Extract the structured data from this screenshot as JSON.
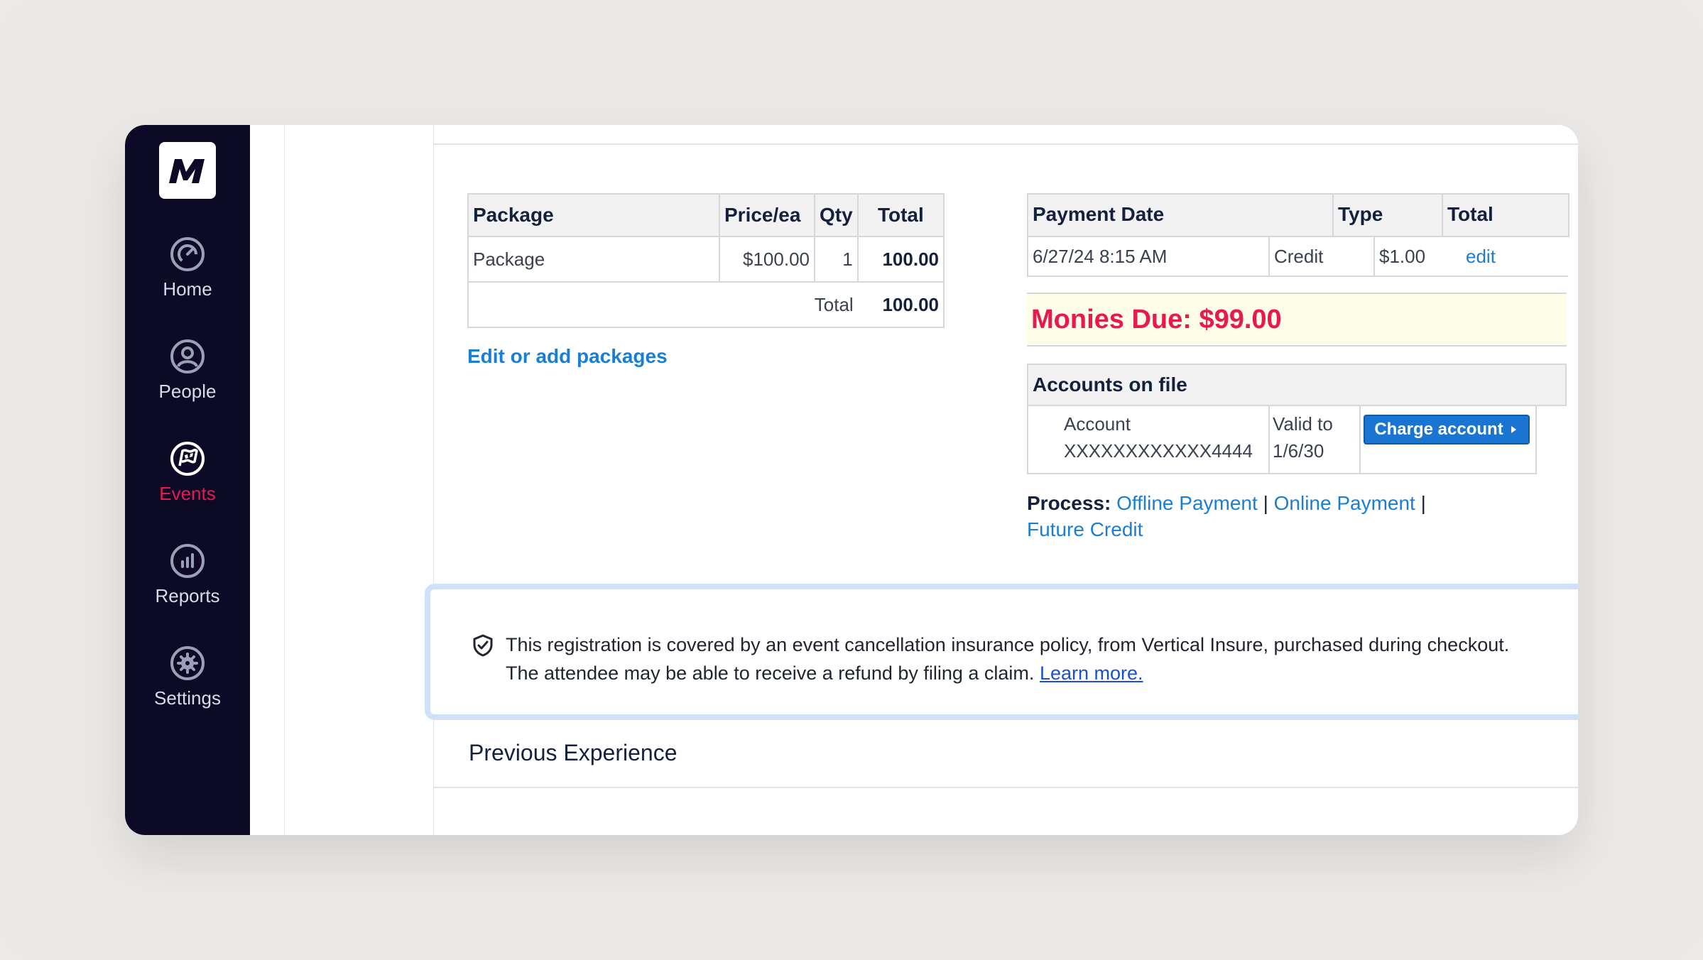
{
  "sidebar": {
    "logo": "M",
    "items": [
      {
        "label": "Home",
        "icon": "speedometer-icon"
      },
      {
        "label": "People",
        "icon": "person-icon"
      },
      {
        "label": "Events",
        "icon": "flag-icon",
        "active": true
      },
      {
        "label": "Reports",
        "icon": "bar-chart-icon"
      },
      {
        "label": "Settings",
        "icon": "gear-icon"
      }
    ]
  },
  "packages": {
    "headers": [
      "Package",
      "Price/ea",
      "Qty",
      "Total"
    ],
    "rows": [
      {
        "package": "Package",
        "price": "$100.00",
        "qty": "1",
        "total": "100.00"
      }
    ],
    "total_label": "Total",
    "total_value": "100.00",
    "edit_link": "Edit or add packages"
  },
  "payments": {
    "headers": [
      "Payment Date",
      "Type",
      "Total"
    ],
    "rows": [
      {
        "date": "6/27/24 8:15 AM",
        "type": "Credit",
        "total": "$1.00",
        "action": "edit"
      }
    ],
    "monies_due": "Monies Due: $99.00"
  },
  "accounts": {
    "title": "Accounts on file",
    "account_label": "Account",
    "account_number": "XXXXXXXXXXXX4444",
    "valid_label": "Valid to",
    "valid_date": "1/6/30",
    "charge_button": "Charge account"
  },
  "process": {
    "label": "Process:",
    "links": [
      "Offline Payment",
      "Online Payment",
      "Future Credit"
    ],
    "separator": "|"
  },
  "insurance": {
    "line1": "This registration is covered by an event cancellation insurance policy, from Vertical Insure, purchased during checkout.",
    "line2": "The attendee may be able to receive a refund by filing a claim.",
    "link": "Learn more."
  },
  "section": {
    "previous_experience": "Previous Experience"
  },
  "colors": {
    "sidebar_bg": "#0c0a26",
    "accent_red": "#e8194f",
    "link_blue": "#1a7fd4",
    "button_blue": "#1a75d2",
    "highlight_border": "#cfe0fa"
  }
}
